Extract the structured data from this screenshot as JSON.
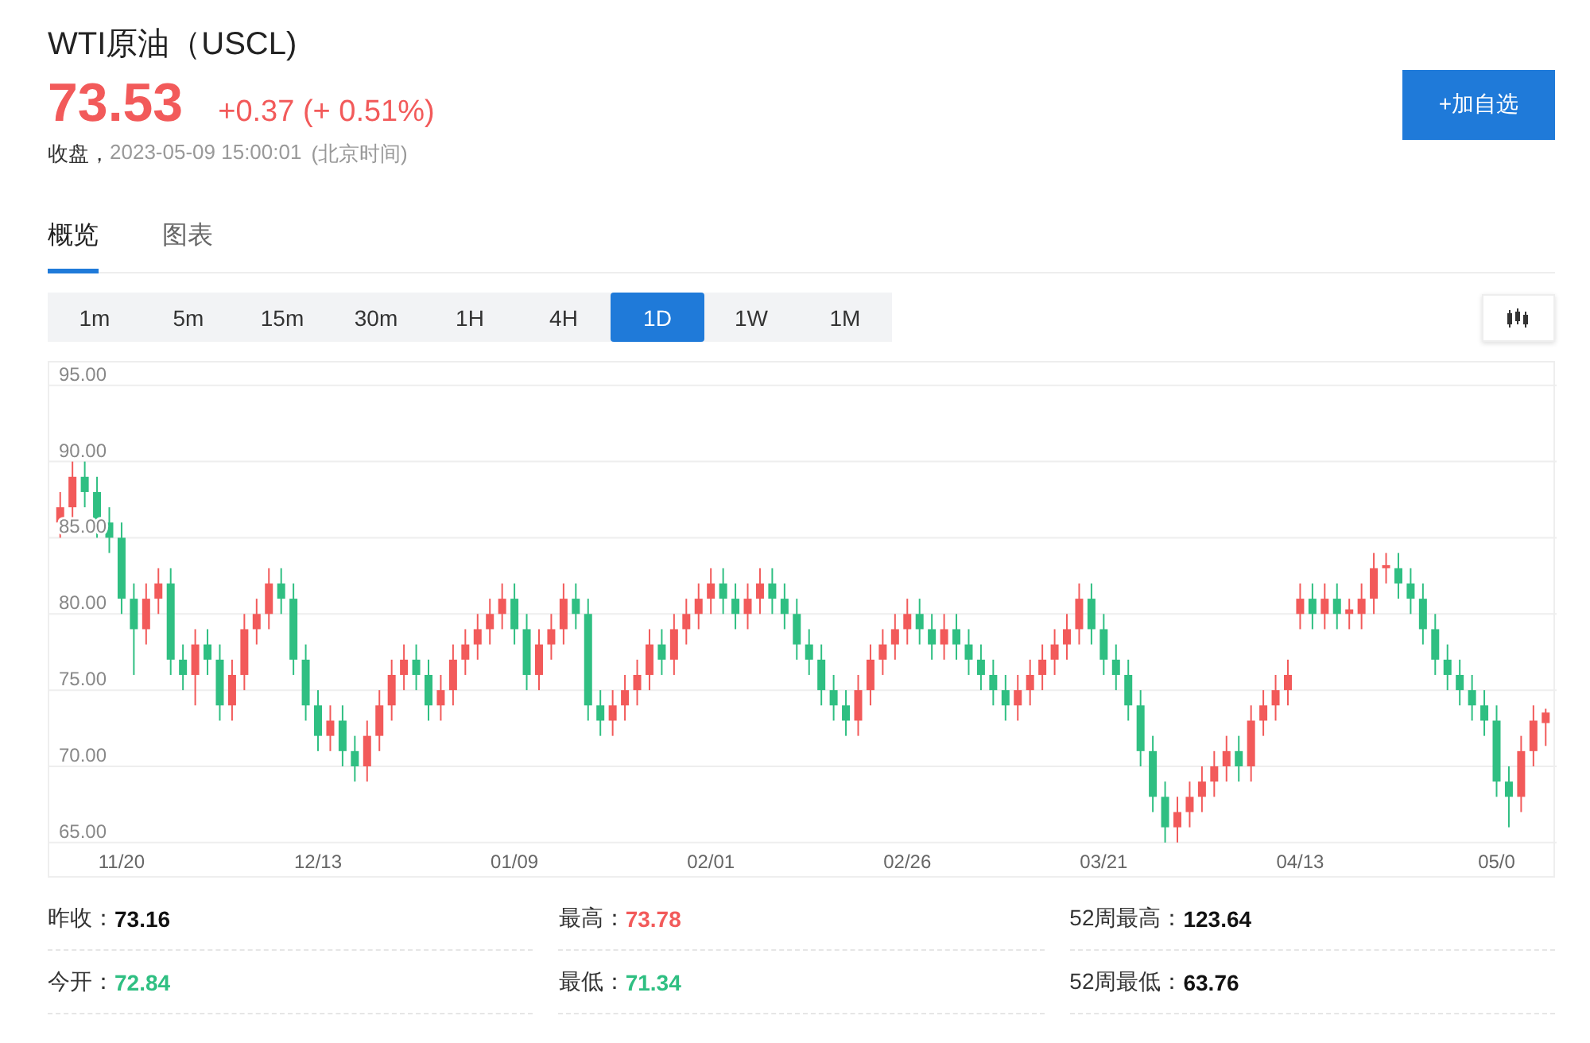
{
  "header": {
    "title": "WTI原油（USCL)",
    "price": "73.53",
    "change": "+0.37 (+ 0.51%)",
    "color": "#f25a5a",
    "status_label": "收盘，",
    "timestamp": "2023-05-09 15:00:01",
    "timezone": "(北京时间)"
  },
  "add_button": "+加自选",
  "tabs": [
    {
      "label": "概览",
      "selected": true
    },
    {
      "label": "图表",
      "selected": false
    }
  ],
  "intervals": [
    {
      "label": "1m",
      "selected": false
    },
    {
      "label": "5m",
      "selected": false
    },
    {
      "label": "15m",
      "selected": false
    },
    {
      "label": "30m",
      "selected": false
    },
    {
      "label": "1H",
      "selected": false
    },
    {
      "label": "4H",
      "selected": false
    },
    {
      "label": "1D",
      "selected": true
    },
    {
      "label": "1W",
      "selected": false
    },
    {
      "label": "1M",
      "selected": false
    }
  ],
  "chart": {
    "x_labels": [
      "11/20",
      "12/13",
      "01/09",
      "02/01",
      "02/26",
      "03/21",
      "04/13",
      "05/0"
    ],
    "chart_data": {
      "type": "candlestick",
      "ylim": [
        62.8,
        96.5
      ],
      "grid": true,
      "yticks": [
        {
          "value": 95,
          "label": "95.00"
        },
        {
          "value": 90,
          "label": "90.00"
        },
        {
          "value": 85,
          "label": "85.00"
        },
        {
          "value": 80,
          "label": "80.00"
        },
        {
          "value": 75,
          "label": "75.00"
        },
        {
          "value": 70,
          "label": "70.00"
        },
        {
          "value": 65,
          "label": "65.00"
        }
      ],
      "ohlc": [
        [
          86,
          88,
          85,
          87
        ],
        [
          87,
          90,
          86,
          89
        ],
        [
          89,
          90,
          87,
          88
        ],
        [
          88,
          89,
          85,
          86
        ],
        [
          86,
          87,
          84,
          85
        ],
        [
          85,
          86,
          80,
          81
        ],
        [
          81,
          82,
          76,
          79
        ],
        [
          79,
          82,
          78,
          81
        ],
        [
          81,
          83,
          80,
          82
        ],
        [
          82,
          83,
          76,
          77
        ],
        [
          77,
          78,
          75,
          76
        ],
        [
          76,
          79,
          74,
          78
        ],
        [
          78,
          79,
          76,
          77
        ],
        [
          77,
          78,
          73,
          74
        ],
        [
          74,
          77,
          73,
          76
        ],
        [
          76,
          80,
          75,
          79
        ],
        [
          79,
          81,
          78,
          80
        ],
        [
          80,
          83,
          79,
          82
        ],
        [
          82,
          83,
          80,
          81
        ],
        [
          81,
          82,
          76,
          77
        ],
        [
          77,
          78,
          73,
          74
        ],
        [
          74,
          75,
          71,
          72
        ],
        [
          72,
          74,
          71,
          73
        ],
        [
          73,
          74,
          70,
          71
        ],
        [
          71,
          72,
          69,
          70
        ],
        [
          70,
          73,
          69,
          72
        ],
        [
          72,
          75,
          71,
          74
        ],
        [
          74,
          77,
          73,
          76
        ],
        [
          76,
          78,
          75,
          77
        ],
        [
          77,
          78,
          75,
          76
        ],
        [
          76,
          77,
          73,
          74
        ],
        [
          74,
          76,
          73,
          75
        ],
        [
          75,
          78,
          74,
          77
        ],
        [
          77,
          79,
          76,
          78
        ],
        [
          78,
          80,
          77,
          79
        ],
        [
          79,
          81,
          78,
          80
        ],
        [
          80,
          82,
          79,
          81
        ],
        [
          81,
          82,
          78,
          79
        ],
        [
          79,
          80,
          75,
          76
        ],
        [
          76,
          79,
          75,
          78
        ],
        [
          78,
          80,
          77,
          79
        ],
        [
          79,
          82,
          78,
          81
        ],
        [
          81,
          82,
          79,
          80
        ],
        [
          80,
          81,
          73,
          74
        ],
        [
          74,
          75,
          72,
          73
        ],
        [
          73,
          75,
          72,
          74
        ],
        [
          74,
          76,
          73,
          75
        ],
        [
          75,
          77,
          74,
          76
        ],
        [
          76,
          79,
          75,
          78
        ],
        [
          78,
          79,
          76,
          77
        ],
        [
          77,
          80,
          76,
          79
        ],
        [
          79,
          81,
          78,
          80
        ],
        [
          80,
          82,
          79,
          81
        ],
        [
          81,
          83,
          80,
          82
        ],
        [
          82,
          83,
          80,
          81
        ],
        [
          81,
          82,
          79,
          80
        ],
        [
          80,
          82,
          79,
          81
        ],
        [
          81,
          83,
          80,
          82
        ],
        [
          82,
          83,
          80,
          81
        ],
        [
          81,
          82,
          79,
          80
        ],
        [
          80,
          81,
          77,
          78
        ],
        [
          78,
          79,
          76,
          77
        ],
        [
          77,
          78,
          74,
          75
        ],
        [
          75,
          76,
          73,
          74
        ],
        [
          74,
          75,
          72,
          73
        ],
        [
          73,
          76,
          72,
          75
        ],
        [
          75,
          78,
          74,
          77
        ],
        [
          77,
          79,
          76,
          78
        ],
        [
          78,
          80,
          77,
          79
        ],
        [
          79,
          81,
          78,
          80
        ],
        [
          80,
          81,
          78,
          79
        ],
        [
          79,
          80,
          77,
          78
        ],
        [
          78,
          80,
          77,
          79
        ],
        [
          79,
          80,
          77,
          78
        ],
        [
          78,
          79,
          76,
          77
        ],
        [
          77,
          78,
          75,
          76
        ],
        [
          76,
          77,
          74,
          75
        ],
        [
          75,
          76,
          73,
          74
        ],
        [
          74,
          76,
          73,
          75
        ],
        [
          75,
          77,
          74,
          76
        ],
        [
          76,
          78,
          75,
          77
        ],
        [
          77,
          79,
          76,
          78
        ],
        [
          78,
          80,
          77,
          79
        ],
        [
          79,
          82,
          78,
          81
        ],
        [
          81,
          82,
          78,
          79
        ],
        [
          79,
          80,
          76,
          77
        ],
        [
          77,
          78,
          75,
          76
        ],
        [
          76,
          77,
          73,
          74
        ],
        [
          74,
          75,
          70,
          71
        ],
        [
          71,
          72,
          67,
          68
        ],
        [
          68,
          69,
          65,
          66
        ],
        [
          66,
          68,
          65,
          67
        ],
        [
          67,
          69,
          66,
          68
        ],
        [
          68,
          70,
          67,
          69
        ],
        [
          69,
          71,
          68,
          70
        ],
        [
          70,
          72,
          69,
          71
        ],
        [
          71,
          72,
          69,
          70
        ],
        [
          70,
          74,
          69,
          73
        ],
        [
          73,
          75,
          72,
          74
        ],
        [
          74,
          76,
          73,
          75
        ],
        [
          75,
          77,
          74,
          76
        ],
        [
          80,
          82,
          79,
          81
        ],
        [
          81,
          82,
          79,
          80
        ],
        [
          80,
          82,
          79,
          81
        ],
        [
          81,
          82,
          79,
          80
        ],
        [
          80,
          81,
          79,
          80.3
        ],
        [
          80,
          82,
          79,
          81
        ],
        [
          81,
          84,
          80,
          83
        ],
        [
          83,
          84,
          82,
          83.2
        ],
        [
          83,
          84,
          81,
          82
        ],
        [
          82,
          83,
          80,
          81
        ],
        [
          81,
          82,
          78,
          79
        ],
        [
          79,
          80,
          76,
          77
        ],
        [
          77,
          78,
          75,
          76
        ],
        [
          76,
          77,
          74,
          75
        ],
        [
          75,
          76,
          73,
          74
        ],
        [
          74,
          75,
          72,
          73
        ],
        [
          73,
          74,
          68,
          69
        ],
        [
          69,
          70,
          66,
          68
        ],
        [
          68,
          72,
          67,
          71
        ],
        [
          71,
          74,
          70,
          73
        ],
        [
          72.84,
          73.78,
          71.34,
          73.53
        ]
      ]
    }
  },
  "stats": [
    {
      "label": "昨收：",
      "value": "73.16",
      "color": "#111111"
    },
    {
      "label": "最高：",
      "value": "73.78",
      "color": "#f25a5a"
    },
    {
      "label": "52周最高：",
      "value": "123.64",
      "color": "#111111"
    },
    {
      "label": "今开：",
      "value": "72.84",
      "color": "#2fbf82"
    },
    {
      "label": "最低：",
      "value": "71.34",
      "color": "#2fbf82"
    },
    {
      "label": "52周最低：",
      "value": "63.76",
      "color": "#111111"
    }
  ]
}
